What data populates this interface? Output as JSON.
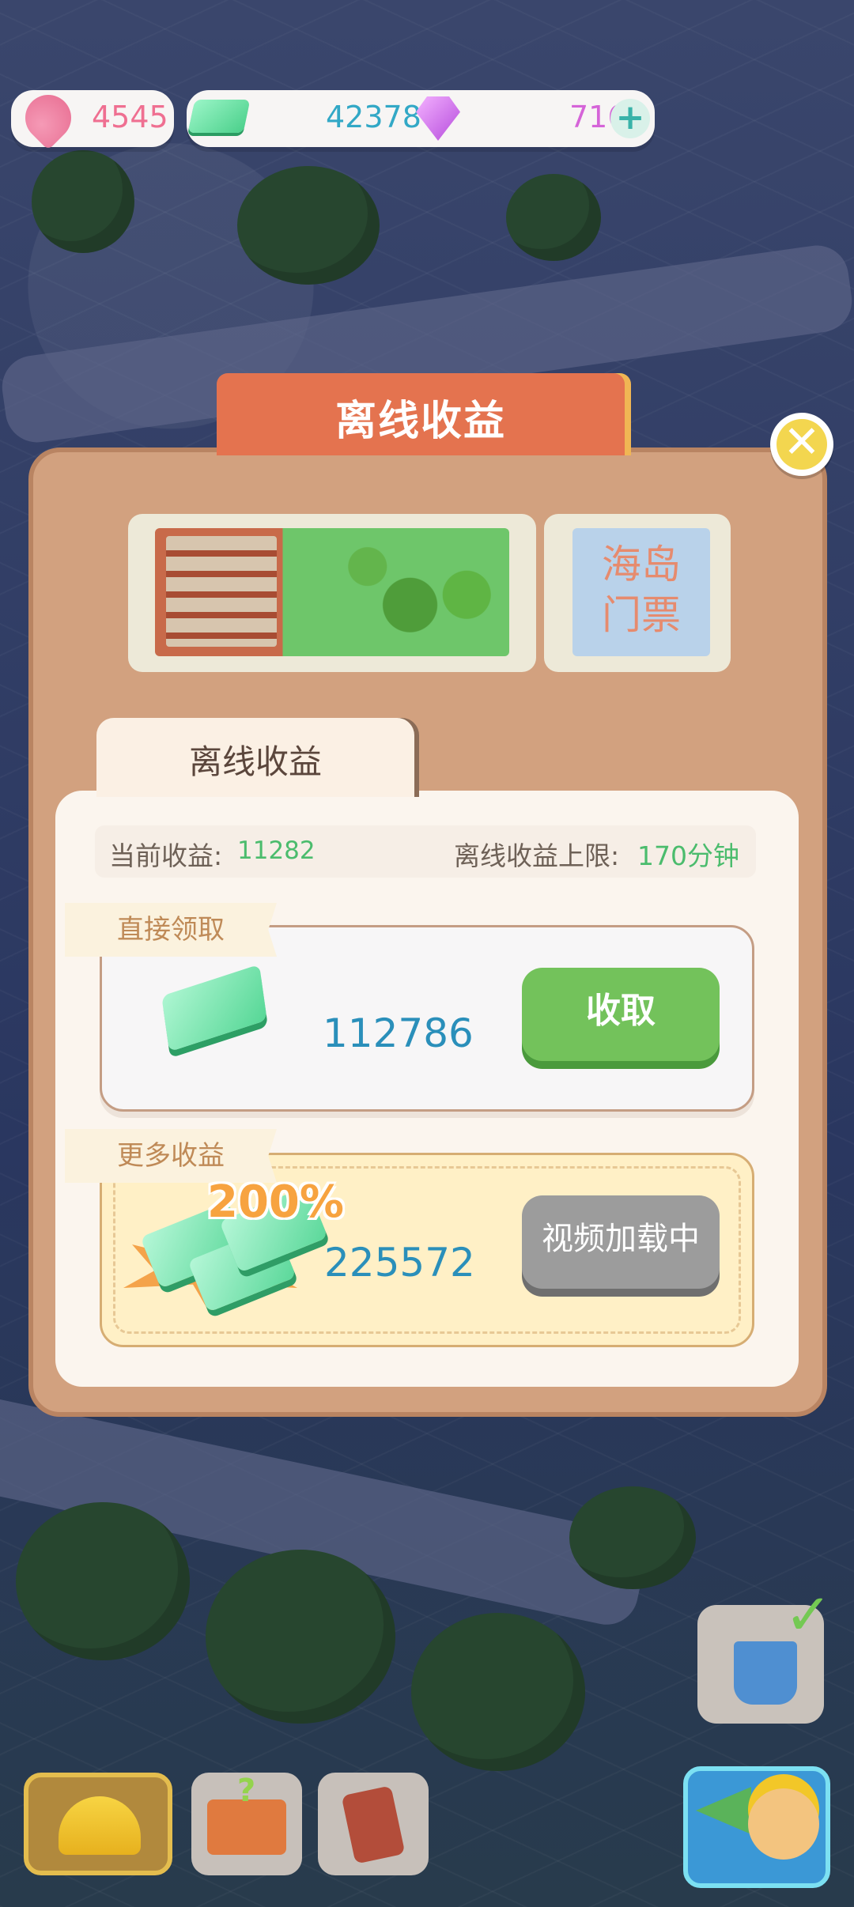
{
  "resources": {
    "shells": "4545",
    "cash": "42378",
    "gems": "716",
    "add_symbol": "+"
  },
  "dialog": {
    "title": "离线收益",
    "close_symbol": "✕",
    "ticket_stub_text": "海岛\n门票",
    "tab_label": "离线收益",
    "current_income_label": "当前收益:",
    "current_income_value": "11282",
    "offline_limit_label": "离线收益上限:",
    "offline_limit_value": "170分钟",
    "direct": {
      "label": "直接领取",
      "amount": "112786",
      "button": "收取"
    },
    "more": {
      "label": "更多收益",
      "multiplier": "200%",
      "amount": "225572",
      "button": "视频加载中"
    }
  },
  "bottom_bar": {
    "items": [
      "build-helmet",
      "toolbox-help",
      "task-clipboard",
      "announcer"
    ]
  },
  "colors": {
    "title_tab": "#e4734f",
    "dialog_bg": "#d2a17f",
    "collect_button": "#73c25b",
    "video_button": "#9c9c9c",
    "amount_text": "#2a8fba",
    "income_value": "#4bbc6d"
  }
}
